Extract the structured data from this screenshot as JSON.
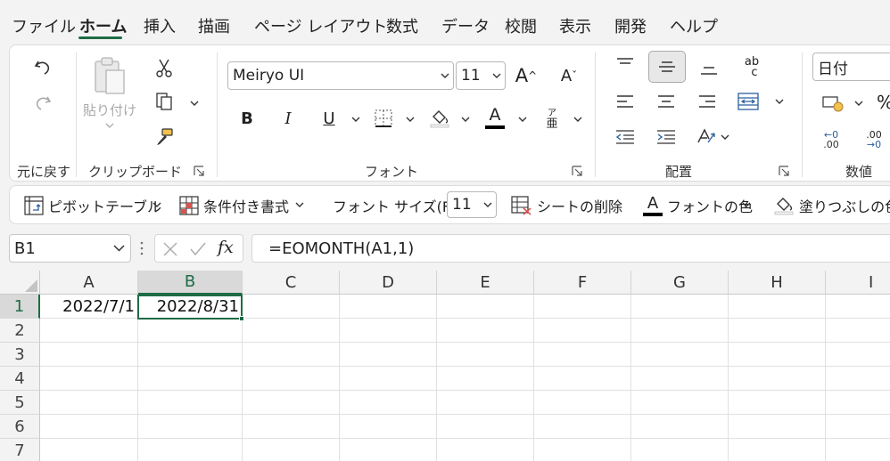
{
  "tabs": [
    "ファイル",
    "ホーム",
    "挿入",
    "描画",
    "ページ レイアウト",
    "数式",
    "データ",
    "校閲",
    "表示",
    "開発",
    "ヘルプ"
  ],
  "active_tab": "ホーム",
  "ribbon": {
    "undo_group_label": "元に戻す",
    "clipboard": {
      "label": "クリップボード",
      "paste_label": "貼り付け"
    },
    "font": {
      "label": "フォント",
      "font_name": "Meiryo UI",
      "font_size": "11",
      "ruby_glyph_top": "ア",
      "ruby_glyph_bottom": "亜",
      "bold_glyph": "B",
      "italic_glyph": "I",
      "underline_glyph": "U",
      "font_color_glyph": "A",
      "grow_glyph": "A",
      "shrink_glyph": "A",
      "font_color_hex": "#000000"
    },
    "alignment": {
      "label": "配置",
      "wrap_text_glyph_top": "ab",
      "wrap_text_glyph_bottom": "c"
    },
    "number": {
      "label": "数値",
      "format": "日付",
      "percent_glyph": "%",
      "inc_decimal_top": "←0",
      "inc_decimal_bottom": ".00",
      "dec_decimal_top": ".00",
      "dec_decimal_bottom": "→0"
    }
  },
  "quick_toolbar": {
    "pivot_table": "ピボットテーブル",
    "conditional_format": "条件付き書式",
    "font_size_label": "フォント サイズ(F):",
    "font_size_value": "11",
    "delete_sheet": "シートの削除",
    "font_color": "フォントの色",
    "fill_color": "塗りつぶしの色",
    "font_color_glyph": "A"
  },
  "formula_bar": {
    "name_box": "B1",
    "fx_label": "fx",
    "formula": "=EOMONTH(A1,1)"
  },
  "grid": {
    "columns": [
      "A",
      "B",
      "C",
      "D",
      "E",
      "F",
      "G",
      "H",
      "I"
    ],
    "rows": [
      "1",
      "2",
      "3",
      "4",
      "5",
      "6",
      "7"
    ],
    "selected_cell": "B1",
    "cells": {
      "A1": "2022/7/1",
      "B1": "2022/8/31"
    }
  },
  "colors": {
    "accent": "#1e6b46",
    "ribbon_bg": "#ffffff",
    "app_bg": "#f3f3f3"
  }
}
